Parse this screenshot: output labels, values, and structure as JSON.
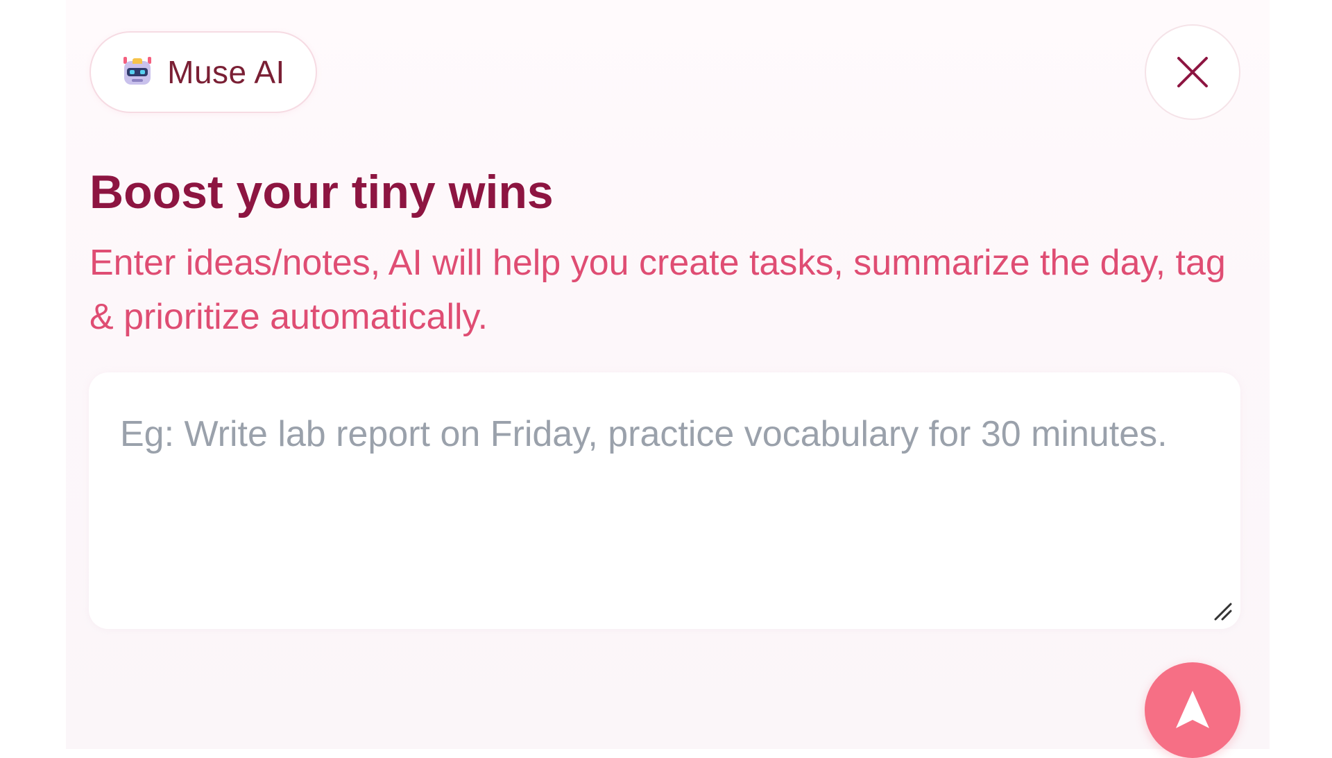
{
  "badge": {
    "label": "Muse AI",
    "icon": "robot-icon"
  },
  "close_button": {
    "icon": "close-icon"
  },
  "heading": "Boost your tiny wins",
  "subtitle": "Enter ideas/notes, AI will help you create tasks, summarize the day, tag & prioritize automatically.",
  "input": {
    "placeholder": "Eg: Write lab report on Friday, practice vocabulary for 30 minutes.",
    "value": "",
    "resize_icon": "resize-handle-icon"
  },
  "send_button": {
    "icon": "send-arrow-icon"
  },
  "colors": {
    "heading": "#8d1541",
    "subtitle": "#df4d73",
    "badge_text": "#7a1f34",
    "send_button": "#f66f85",
    "placeholder": "#9aa1ab"
  }
}
